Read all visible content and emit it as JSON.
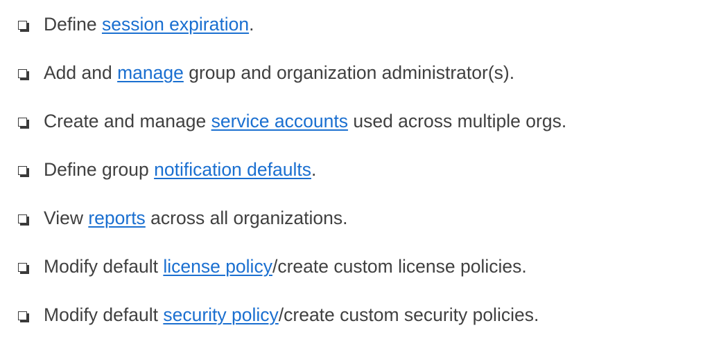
{
  "checklist": {
    "items": [
      {
        "before": "Define ",
        "link": "session expiration",
        "after": "."
      },
      {
        "before": "Add and ",
        "link": "manage",
        "after": " group and organization administrator(s)."
      },
      {
        "before": "Create and manage ",
        "link": "service accounts",
        "after": " used across multiple orgs."
      },
      {
        "before": "Define group ",
        "link": "notification defaults",
        "after": "."
      },
      {
        "before": "View ",
        "link": "reports",
        "after": " across all organizations."
      },
      {
        "before": "Modify default ",
        "link": "license policy",
        "after": "/create custom license policies."
      },
      {
        "before": "Modify default ",
        "link": "security policy",
        "after": "/create custom security policies."
      }
    ]
  },
  "colors": {
    "text": "#404040",
    "link": "#1a6fd0",
    "checkbox": "#3a3a3a"
  },
  "icons": {
    "checkbox": "empty-checkbox-icon"
  }
}
